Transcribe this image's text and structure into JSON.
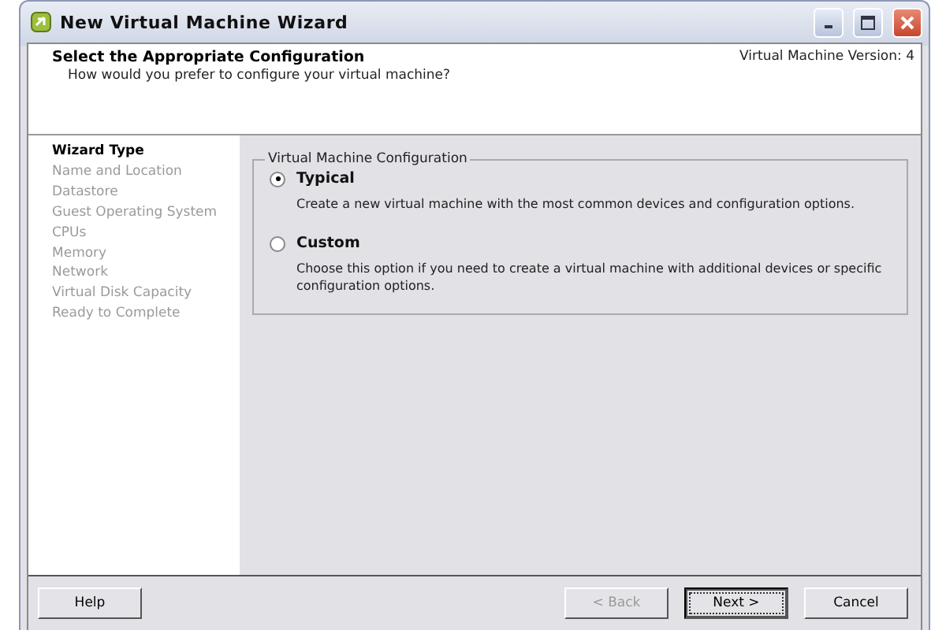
{
  "window": {
    "title": "New Virtual Machine Wizard"
  },
  "header": {
    "title": "Select the Appropriate Configuration",
    "subtitle": "How would you prefer to configure your virtual machine?",
    "version": "Virtual Machine Version: 4"
  },
  "sidebar": {
    "items": [
      {
        "label": "Wizard Type",
        "selected": true
      },
      {
        "label": "Name and Location",
        "selected": false
      },
      {
        "label": "Datastore",
        "selected": false
      },
      {
        "label": "Guest Operating System",
        "selected": false
      },
      {
        "label": "CPUs",
        "selected": false
      },
      {
        "label": "Memory",
        "selected": false
      },
      {
        "label": "Network",
        "selected": false
      },
      {
        "label": "Virtual Disk Capacity",
        "selected": false
      },
      {
        "label": "Ready to Complete",
        "selected": false
      }
    ]
  },
  "group": {
    "title": "Virtual Machine Configuration",
    "options": [
      {
        "label": "Typical",
        "description": "Create a new virtual machine with the most common devices and configuration options.",
        "selected": true
      },
      {
        "label": "Custom",
        "description": "Choose this option if you need to create a virtual machine with additional devices or specific configuration options.",
        "selected": false
      }
    ]
  },
  "footer": {
    "help": "Help",
    "buttons": [
      {
        "label": "< Back",
        "disabled": true,
        "default": false
      },
      {
        "label": "Next >",
        "disabled": false,
        "default": true
      },
      {
        "label": "Cancel",
        "disabled": false,
        "default": false
      }
    ]
  }
}
